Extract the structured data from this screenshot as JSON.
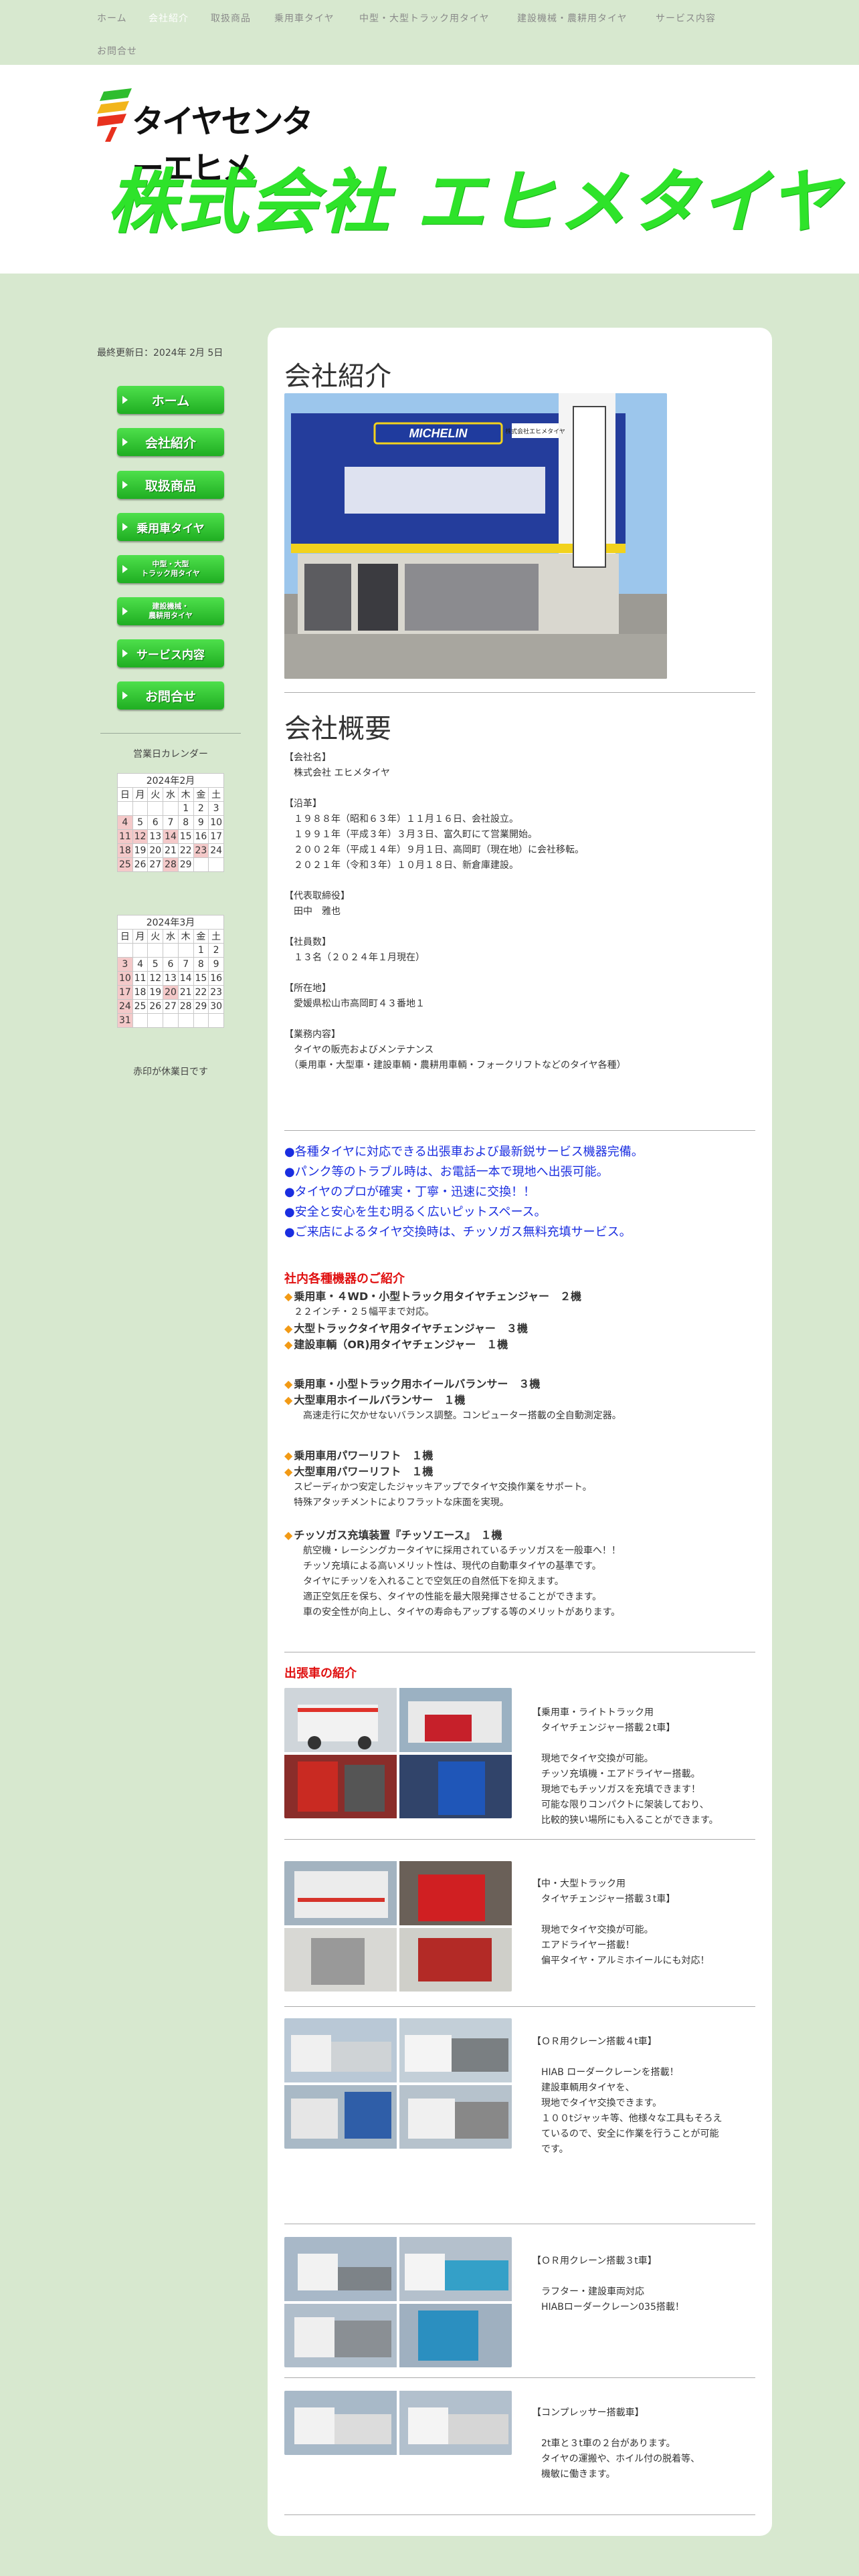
{
  "top_nav": {
    "items": [
      {
        "label": "ホーム"
      },
      {
        "label": "会社紹介"
      },
      {
        "label": "取扱商品"
      },
      {
        "label": "乗用車タイヤ"
      },
      {
        "label": "中型・大型トラック用タイヤ"
      },
      {
        "label": "建設機械・農耕用タイヤ"
      },
      {
        "label": "サービス内容"
      },
      {
        "label": "お問合せ"
      }
    ]
  },
  "header": {
    "logo_text": "タイヤセンターエヒメ",
    "company_name": "株式会社 エヒメタイヤ"
  },
  "sidebar": {
    "updated": "最終更新日：2024年 2月 5日",
    "buttons": [
      "ホーム",
      "会社紹介",
      "取扱商品",
      "乗用車タイヤ",
      "中型・大型\nトラック用タイヤ",
      "建設機械・\n農耕用タイヤ",
      "サービス内容",
      "お問合せ"
    ],
    "calendar_title": "営業日カレンダー",
    "cal_feb": "2024年2月",
    "cal_mar": "2024年3月",
    "weekdays": [
      "日",
      "月",
      "火",
      "水",
      "木",
      "金",
      "土"
    ],
    "note": "赤印が休業日です"
  },
  "calendars": {
    "feb": [
      [
        "",
        "",
        "",
        "",
        "1",
        "2",
        "3"
      ],
      [
        "4",
        "5",
        "6",
        "7",
        "8",
        "9",
        "10"
      ],
      [
        "11",
        "12",
        "13",
        "14",
        "15",
        "16",
        "17"
      ],
      [
        "18",
        "19",
        "20",
        "21",
        "22",
        "23",
        "24"
      ],
      [
        "25",
        "26",
        "27",
        "28",
        "29",
        "",
        ""
      ]
    ],
    "feb_holidays": [
      "4",
      "11",
      "12",
      "14",
      "18",
      "23",
      "25",
      "28"
    ],
    "mar": [
      [
        "",
        "",
        "",
        "",
        "",
        "1",
        "2"
      ],
      [
        "3",
        "4",
        "5",
        "6",
        "7",
        "8",
        "9"
      ],
      [
        "10",
        "11",
        "12",
        "13",
        "14",
        "15",
        "16"
      ],
      [
        "17",
        "18",
        "19",
        "20",
        "21",
        "22",
        "23"
      ],
      [
        "24",
        "25",
        "26",
        "27",
        "28",
        "29",
        "30"
      ],
      [
        "31",
        "",
        "",
        "",
        "",
        "",
        ""
      ]
    ],
    "mar_holidays": [
      "3",
      "10",
      "17",
      "20",
      "24",
      "31"
    ]
  },
  "main": {
    "heading_intro": "会社紹介",
    "sign_text": "株式会社エヒメタイヤ",
    "sign_brand": "MICHELIN",
    "heading_overview": "会社概要",
    "overview": "【会社名】\n　株式会社 エヒメタイヤ\n\n【沿革】\n　１９８８年（昭和６３年）１１月１６日、会社設立。\n　１９９１年（平成３年）３月３日、富久町にて営業開始。\n　２００２年（平成１４年）９月１日、高岡町（現在地）に会社移転。\n　２０２１年（令和３年）１０月１８日、新倉庫建設。\n\n【代表取締役】\n　田中　雅也\n\n【社員数】\n　１３名（２０２４年１月現在）\n\n【所在地】\n　愛媛県松山市高岡町４３番地１\n\n【業務内容】\n　タイヤの販売およびメンテナンス\n　（乗用車・大型車・建設車輌・農耕用車輌・フォークリフトなどのタイヤ各種）",
    "features": [
      "●各種タイヤに対応できる出張車および最新鋭サービス機器完備。",
      "●パンク等のトラブル時は、お電話一本で現地へ出張可能。",
      "●タイヤのプロが確実・丁寧・迅速に交換！！",
      "●安全と安心を生む明るく広いピットスペース。",
      "●ご来店によるタイヤ交換時は、チッソガス無料充填サービス。"
    ],
    "equip_heading": "社内各種機器のご紹介",
    "equip": [
      {
        "t": "乗用車・４WD・小型トラック用タイヤチェンジャー　２機",
        "d": "　２２インチ・２５幅平まで対応。"
      },
      {
        "t": "大型トラックタイヤ用タイヤチェンジャー　３機",
        "d": ""
      },
      {
        "t": "建設車輌（OR)用タイヤチェンジャー　１機",
        "d": ""
      },
      {
        "t": "乗用車・小型トラック用ホイールバランサー　３機",
        "d": ""
      },
      {
        "t": "大型車用ホイールバランサー　１機",
        "d": "　　高速走行に欠かせないバランス調整。コンピューター搭載の全自動測定器。"
      },
      {
        "t": "乗用車用パワーリフト　１機",
        "d": ""
      },
      {
        "t": "大型車用パワーリフト　１機",
        "d": "　スピーディかつ安定したジャッキアップでタイヤ交換作業をサポート。\n　特殊アタッチメントによりフラットな床面を実現。"
      },
      {
        "t": "チッソガス充填装置『チッソエース』　１機",
        "d": "　　航空機・レーシングカータイヤに採用されているチッソガスを一般車へ！！\n　　チッソ充填による高いメリット性は、現代の自動車タイヤの基準です。\n　　タイヤにチッソを入れることで空気圧の自然低下を抑えます。\n　　適正空気圧を保ち、タイヤの性能を最大限発揮させることができます。\n　　車の安全性が向上し、タイヤの寿命もアップする等のメリットがあります。"
      }
    ],
    "vehicles_heading": "出張車の紹介",
    "vehicles": [
      "【乗用車・ライトトラック用\n　タイヤチェンジャー搭載２t車】\n\n　現地でタイヤ交換が可能。\n　チッソ充填機・エアドライヤー搭載。\n　現地でもチッソガスを充填できます！\n　可能な限りコンパクトに架装しており、\n　比較的狭い場所にも入ることができます。",
      "【中・大型トラック用\n　タイヤチェンジャー搭載３t車】\n\n　現地でタイヤ交換が可能。\n　エアドライヤー搭載！\n　偏平タイヤ・アルミホイールにも対応！",
      "【ＯＲ用クレーン搭載４t車】\n\n　HIAB ローダークレーンを搭載！\n　建設車輌用タイヤを、\n　現地でタイヤ交換できます。\n　１００tジャッキ等、他様々な工具もそろえ\n　ているので、安全に作業を行うことが可能\n　です。",
      "【ＯＲ用クレーン搭載３t車】\n\n　ラフター・建設車両対応\n　HIABローダークレーン035搭載！",
      "【コンプレッサー搭載車】\n\n　2t車と３t車の２台があります。\n　タイヤの運搬や、ホイル付の脱着等、\n　機敏に働きます。"
    ]
  },
  "colors": {
    "page_bg": "#d7e8cf",
    "accent_green": "#2ee32a",
    "feature_blue": "#1a2ee0",
    "heading_red": "#e01010",
    "holiday_pink": "#f4c9c9"
  }
}
